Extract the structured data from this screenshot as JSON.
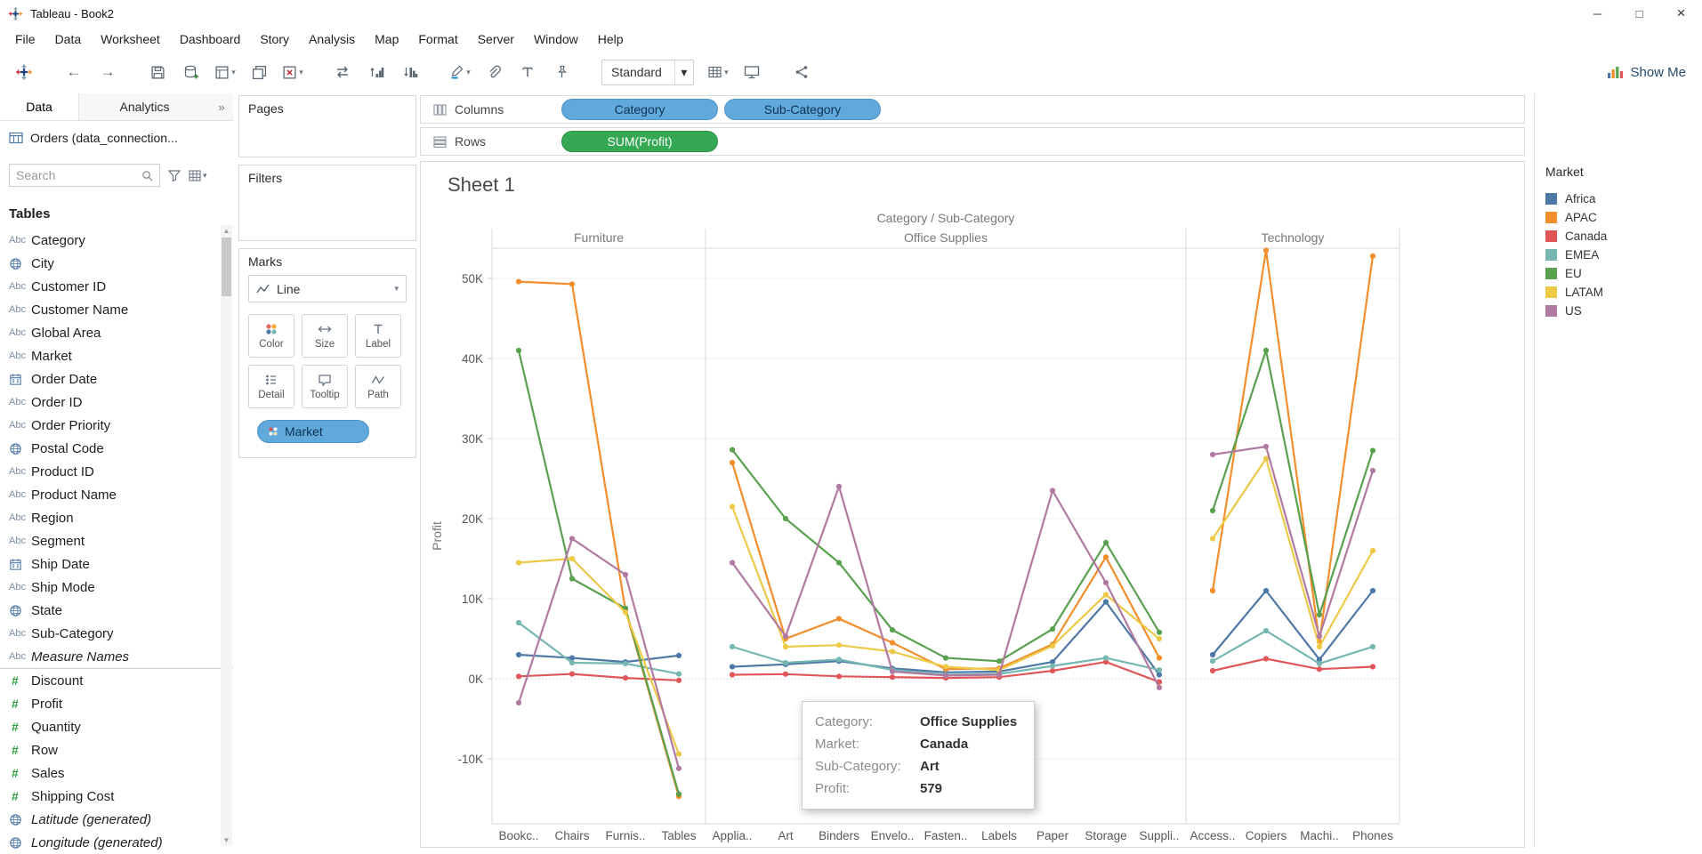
{
  "window": {
    "title": "Tableau - Book2",
    "menu": [
      "File",
      "Data",
      "Worksheet",
      "Dashboard",
      "Story",
      "Analysis",
      "Map",
      "Format",
      "Server",
      "Window",
      "Help"
    ]
  },
  "toolbar": {
    "fit_label": "Standard",
    "show_me_label": "Show Me"
  },
  "data_pane": {
    "tabs": {
      "data": "Data",
      "analytics": "Analytics"
    },
    "data_source": "Orders (data_connection...",
    "search_placeholder": "Search",
    "tables_header": "Tables",
    "fields": [
      {
        "name": "Category",
        "icon": "abc"
      },
      {
        "name": "City",
        "icon": "globe"
      },
      {
        "name": "Customer ID",
        "icon": "abc"
      },
      {
        "name": "Customer Name",
        "icon": "abc"
      },
      {
        "name": "Global Area",
        "icon": "abc"
      },
      {
        "name": "Market",
        "icon": "abc"
      },
      {
        "name": "Order Date",
        "icon": "calendar"
      },
      {
        "name": "Order ID",
        "icon": "abc"
      },
      {
        "name": "Order Priority",
        "icon": "abc"
      },
      {
        "name": "Postal Code",
        "icon": "globe"
      },
      {
        "name": "Product ID",
        "icon": "abc"
      },
      {
        "name": "Product Name",
        "icon": "abc"
      },
      {
        "name": "Region",
        "icon": "abc"
      },
      {
        "name": "Segment",
        "icon": "abc"
      },
      {
        "name": "Ship Date",
        "icon": "calendar"
      },
      {
        "name": "Ship Mode",
        "icon": "abc"
      },
      {
        "name": "State",
        "icon": "globe"
      },
      {
        "name": "Sub-Category",
        "icon": "abc"
      },
      {
        "name": "Measure Names",
        "icon": "abc",
        "italic": true,
        "divider_after": true
      },
      {
        "name": "Discount",
        "icon": "hash"
      },
      {
        "name": "Profit",
        "icon": "hash"
      },
      {
        "name": "Quantity",
        "icon": "hash"
      },
      {
        "name": "Row",
        "icon": "hash"
      },
      {
        "name": "Sales",
        "icon": "hash"
      },
      {
        "name": "Shipping Cost",
        "icon": "hash"
      },
      {
        "name": "Latitude (generated)",
        "icon": "globe",
        "italic": true
      },
      {
        "name": "Longitude (generated)",
        "icon": "globe",
        "italic": true
      }
    ]
  },
  "cards": {
    "pages_label": "Pages",
    "filters_label": "Filters",
    "marks": {
      "label": "Marks",
      "mark_type": "Line",
      "buttons": [
        "Color",
        "Size",
        "Label",
        "Detail",
        "Tooltip",
        "Path"
      ],
      "pills": [
        {
          "label": "Market"
        }
      ]
    }
  },
  "shelves": {
    "columns_label": "Columns",
    "rows_label": "Rows",
    "columns_pills": [
      "Category",
      "Sub-Category"
    ],
    "rows_pills": [
      "SUM(Profit)"
    ]
  },
  "sheet": {
    "title": "Sheet 1"
  },
  "legend": {
    "title": "Market",
    "items": [
      {
        "label": "Africa",
        "color": "#4e79a7"
      },
      {
        "label": "APAC",
        "color": "#f28e2b"
      },
      {
        "label": "Canada",
        "color": "#e15759"
      },
      {
        "label": "EMEA",
        "color": "#76b7b2"
      },
      {
        "label": "EU",
        "color": "#59a14f"
      },
      {
        "label": "LATAM",
        "color": "#edc948"
      },
      {
        "label": "US",
        "color": "#b07aa1"
      }
    ]
  },
  "tooltip": {
    "rows": [
      {
        "label": "Category:",
        "value": "Office Supplies"
      },
      {
        "label": "Market:",
        "value": "Canada"
      },
      {
        "label": "Sub-Category:",
        "value": "Art"
      },
      {
        "label": "Profit:",
        "value": "579"
      }
    ]
  },
  "chart_data": {
    "type": "line",
    "title": "Category / Sub-Category",
    "ylabel": "Profit",
    "ylim": [
      -18000,
      54000
    ],
    "yticks": [
      -10000,
      0,
      10000,
      20000,
      30000,
      40000,
      50000
    ],
    "grid": "horizontal-light",
    "legend_position": "right",
    "panes": [
      {
        "label": "Furniture",
        "categories": [
          "Bookc..",
          "Chairs",
          "Furnis..",
          "Tables"
        ]
      },
      {
        "label": "Office Supplies",
        "categories": [
          "Applia..",
          "Art",
          "Binders",
          "Envelo..",
          "Fasten..",
          "Labels",
          "Paper",
          "Storage",
          "Suppli.."
        ]
      },
      {
        "label": "Technology",
        "categories": [
          "Access..",
          "Copiers",
          "Machi..",
          "Phones"
        ]
      }
    ],
    "series": [
      {
        "name": "Africa",
        "color": "#4e79a7",
        "values": [
          [
            3000,
            2600,
            2100,
            2900
          ],
          [
            1500,
            1800,
            2200,
            1300,
            800,
            900,
            2100,
            9600,
            500
          ],
          [
            3000,
            11000,
            2400,
            11000
          ]
        ]
      },
      {
        "name": "APAC",
        "color": "#f28e2b",
        "values": [
          [
            49600,
            49300,
            8600,
            -14700
          ],
          [
            27000,
            5000,
            7500,
            4500,
            1200,
            1300,
            4300,
            15200,
            2600
          ],
          [
            11000,
            53500,
            4600,
            52800
          ]
        ]
      },
      {
        "name": "Canada",
        "color": "#e15759",
        "values": [
          [
            300,
            600,
            100,
            -200
          ],
          [
            500,
            579,
            300,
            200,
            100,
            200,
            1000,
            2100,
            -400
          ],
          [
            1000,
            2500,
            1200,
            1500
          ]
        ]
      },
      {
        "name": "EMEA",
        "color": "#76b7b2",
        "values": [
          [
            7000,
            2000,
            1900,
            600
          ],
          [
            4000,
            2000,
            2400,
            1100,
            500,
            600,
            1600,
            2600,
            1100
          ],
          [
            2200,
            6000,
            1900,
            4000
          ]
        ]
      },
      {
        "name": "EU",
        "color": "#59a14f",
        "values": [
          [
            41000,
            12500,
            8800,
            -14400
          ],
          [
            28600,
            20000,
            14500,
            6100,
            2600,
            2200,
            6200,
            17000,
            5800
          ],
          [
            21000,
            41000,
            8000,
            28500
          ]
        ]
      },
      {
        "name": "LATAM",
        "color": "#edc948",
        "values": [
          [
            14500,
            15000,
            8300,
            -9400
          ],
          [
            21500,
            4000,
            4200,
            3400,
            1500,
            1100,
            4100,
            10500,
            5000
          ],
          [
            17500,
            27500,
            4000,
            16000
          ]
        ]
      },
      {
        "name": "US",
        "color": "#b07aa1",
        "values": [
          [
            -3000,
            17500,
            13000,
            -11200
          ],
          [
            14500,
            5300,
            24000,
            900,
            400,
            500,
            23500,
            12000,
            -1100
          ],
          [
            28000,
            29000,
            5300,
            26000
          ]
        ]
      }
    ]
  }
}
